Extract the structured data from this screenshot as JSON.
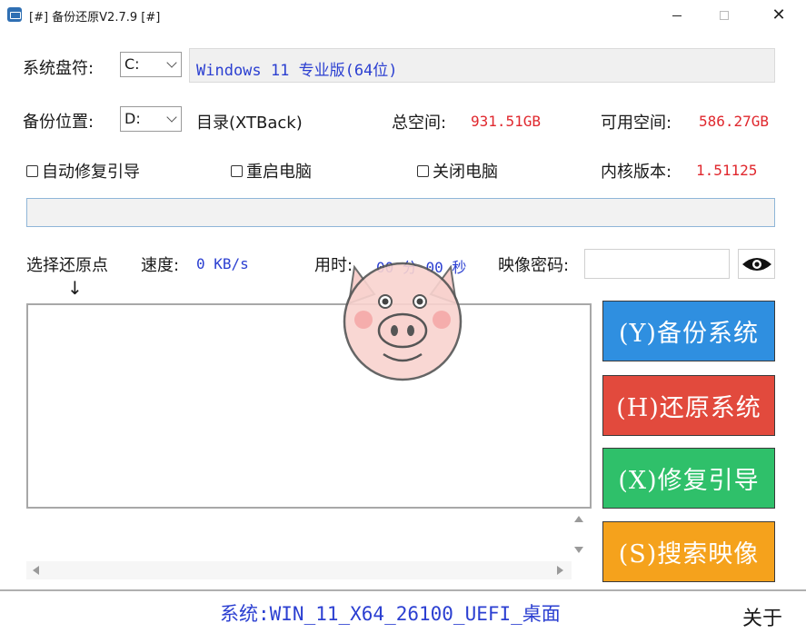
{
  "window": {
    "title": "[#] 备份还原V2.7.9 [#]",
    "min_icon": "minimize-icon",
    "max_icon": "maximize-icon",
    "close_glyph": "✕"
  },
  "system_drive": {
    "label": "系统盘符:",
    "value": "C:"
  },
  "os_info": "Windows 11 专业版(64位)",
  "backup_location": {
    "label": "备份位置:",
    "value": "D:",
    "directory": "目录(XTBack)",
    "total_label": "总空间:",
    "total_value": "931.51GB",
    "free_label": "可用空间:",
    "free_value": "586.27GB"
  },
  "options": {
    "auto_repair_boot": "自动修复引导",
    "restart_pc": "重启电脑",
    "shutdown_pc": "关闭电脑",
    "kernel_label": "内核版本:",
    "kernel_value": "1.51125"
  },
  "progress": {
    "value": 0
  },
  "restore_point": {
    "label": "选择还原点",
    "arrow": "↓",
    "speed_label": "速度:",
    "speed_value": "0 KB/s",
    "time_label": "用时:",
    "time_value": "00 分 00 秒",
    "password_label": "映像密码:",
    "password_value": "",
    "eye_icon": "eye-icon"
  },
  "actions": {
    "backup": "(Y)备份系统",
    "restore": "(H)还原系统",
    "repair": "(X)修复引导",
    "search": "(S)搜索映像"
  },
  "colors": {
    "backup": "#2f8fe0",
    "restore": "#e24a3d",
    "repair": "#2fc06a",
    "search": "#f5a21c",
    "value_red": "#e0282e",
    "value_blue": "#2b3fd1"
  },
  "status_bar": {
    "system": "系统:WIN_11_X64_26100_UEFI_桌面",
    "about": "关于"
  },
  "mascot": "pig-face-icon"
}
